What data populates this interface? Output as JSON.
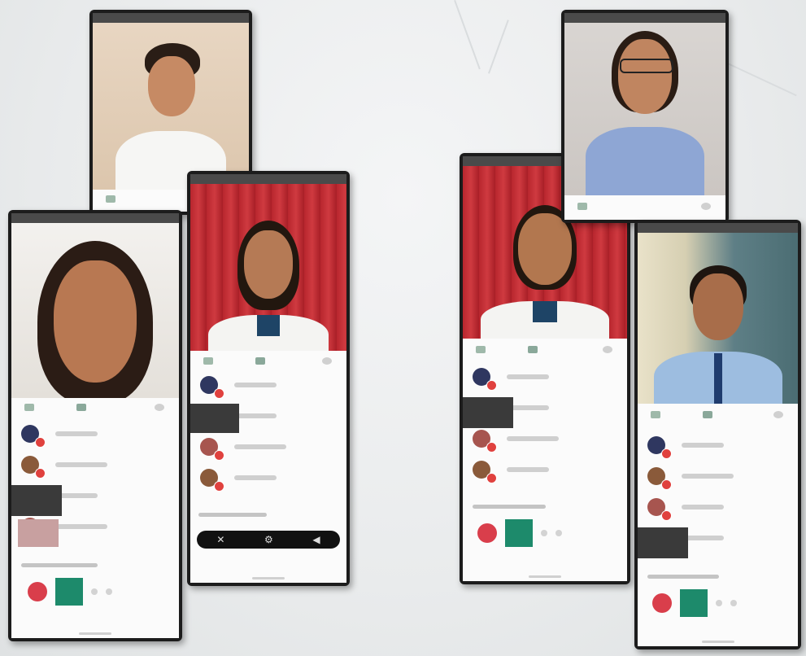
{
  "phones": [
    {
      "id": "phone-1",
      "video": "cam-beige",
      "avatar": "student-boy-white-shirt"
    },
    {
      "id": "phone-2",
      "video": "cam-white",
      "avatar": "student-girl-close-up"
    },
    {
      "id": "phone-3",
      "video": "cam-curtain",
      "avatar": "student-girl-red-curtain"
    },
    {
      "id": "phone-4",
      "video": "cam-curtain",
      "avatar": "student-girl-red-curtain-2"
    },
    {
      "id": "phone-5",
      "video": "cam-wall",
      "avatar": "student-girl-glasses"
    },
    {
      "id": "phone-6",
      "video": "cam-room",
      "avatar": "student-boy-blue-shirt"
    }
  ],
  "nav_icons": {
    "close": "✕",
    "settings": "⚙",
    "volume": "◀"
  },
  "colors": {
    "badge": "#e0413e",
    "tile": "#1d8a6b",
    "call_avatar": "#d93e4b"
  }
}
